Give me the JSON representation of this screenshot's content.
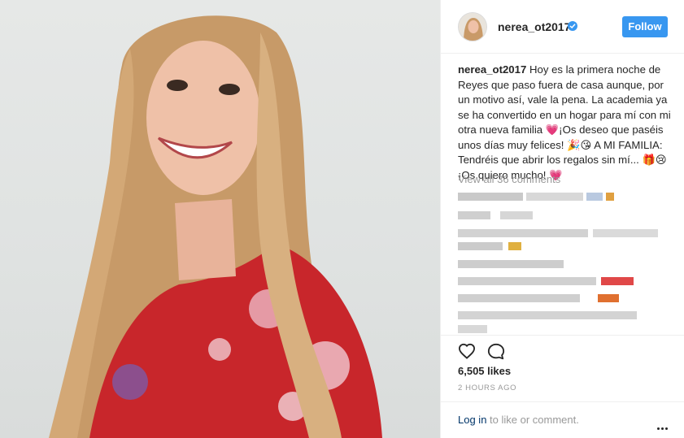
{
  "post": {
    "username": "nerea_ot2017",
    "follow_label": "Follow",
    "caption_user": "nerea_ot2017",
    "caption_text": " Hoy es la primera noche de Reyes que paso fuera de casa aunque, por un motivo así, vale la pena. La academia ya se ha convertido en un hogar para mí con mi otra nueva familia 💗¡Os deseo que paséis unos días muy felices! 🎉😘 A MI FAMILIA: Tendréis que abrir los regalos sin mí... 🎁😢¡Os quiero mucho! 💗",
    "view_all_comments": "View all 36 comments",
    "likes": "6,505 likes",
    "time": "2 HOURS AGO",
    "login_link": "Log in",
    "login_rest": " to like or comment."
  },
  "icons": {
    "verified": "verified-badge-icon",
    "heart": "heart-icon",
    "comment": "comment-icon",
    "more": "more-options-icon"
  },
  "colors": {
    "accent": "#3897f0",
    "link": "#003569",
    "muted": "#999999",
    "text": "#262626"
  }
}
